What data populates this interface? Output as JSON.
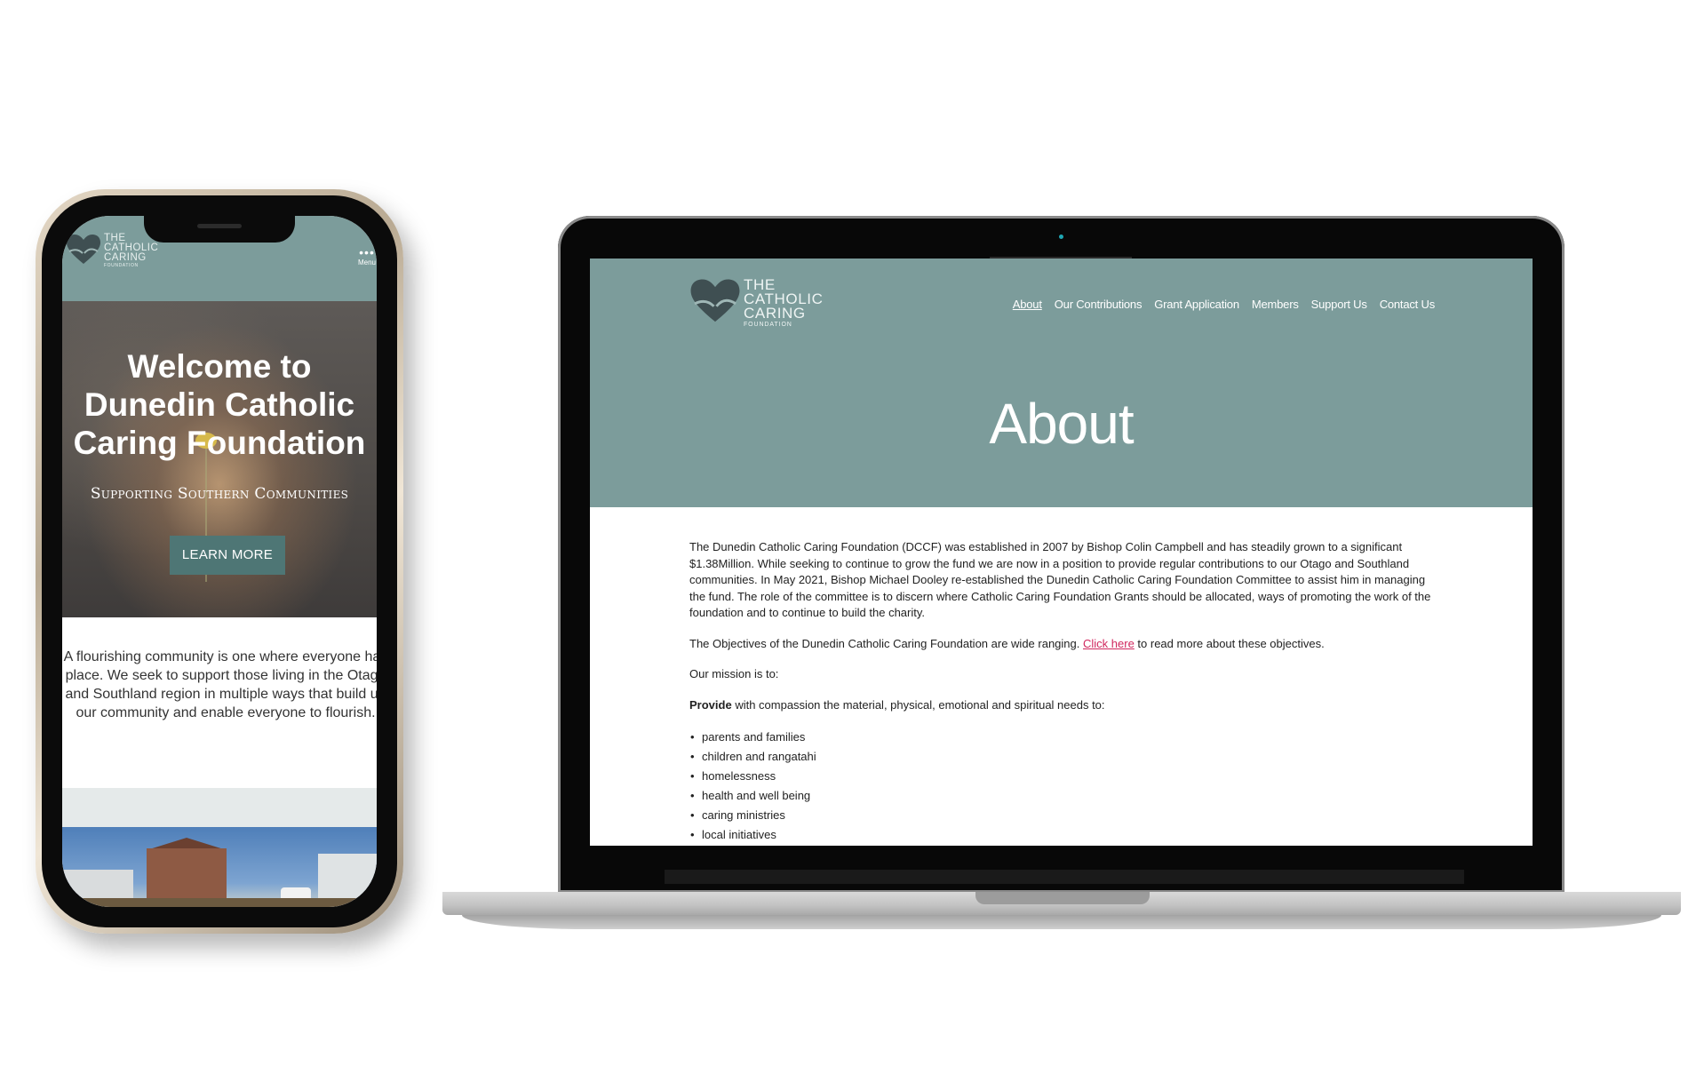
{
  "logo": {
    "lines": [
      "THE",
      "CATHOLIC",
      "CARING"
    ],
    "tagline": "FOUNDATION"
  },
  "mobile": {
    "menu_label": "Menu",
    "hero_title": "Welcome to Dunedin Catholic Caring Foundation",
    "hero_subtitle": "Supporting Southern Communities",
    "learn_more_label": "LEARN MORE",
    "intro_text": "A flourishing community is one where everyone has place. We seek to support those living in the Otago and Southland region in multiple ways that build up our community and enable everyone to flourish."
  },
  "desktop": {
    "nav": [
      {
        "label": "About",
        "active": true
      },
      {
        "label": "Our Contributions",
        "active": false
      },
      {
        "label": "Grant Application",
        "active": false
      },
      {
        "label": "Members",
        "active": false
      },
      {
        "label": "Support Us",
        "active": false
      },
      {
        "label": "Contact Us",
        "active": false
      }
    ],
    "page_title": "About",
    "paragraph1": "The Dunedin Catholic Caring Foundation (DCCF) was established in 2007 by Bishop Colin Campbell and has steadily grown to a significant $1.38Million. While seeking to continue to grow the fund we are now in a position to provide regular contributions to our Otago and Southland communities. In May 2021, Bishop Michael Dooley re-established the Dunedin Catholic Caring Foundation Committee to assist him in managing the fund. The role of the committee is to discern where Catholic Caring Foundation Grants should be allocated, ways of promoting the work of the foundation and to continue to build the charity.",
    "objectives_before": "The Objectives of the Dunedin Catholic Caring Foundation are wide ranging.",
    "objectives_link": "Click here",
    "objectives_after": "to read more about these objectives.",
    "mission_intro": "Our mission is to:",
    "provide_bold": "Provide",
    "provide_rest": "with compassion the material, physical, emotional and spiritual needs to:",
    "needs": [
      "parents and families",
      "children and rangatahi",
      "homelessness",
      "health and well being",
      "caring ministries",
      "local initiatives"
    ]
  },
  "colors": {
    "header_teal": "#7c9c9b",
    "button_teal": "#4e7675",
    "link_pink": "#d0275e"
  }
}
